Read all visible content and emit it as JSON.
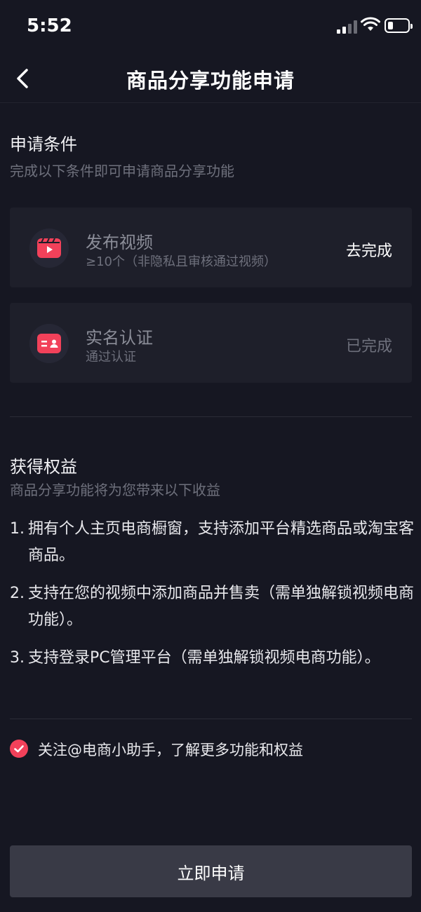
{
  "status_bar": {
    "time": "5:52"
  },
  "nav": {
    "title": "商品分享功能申请"
  },
  "conditions": {
    "title": "申请条件",
    "subtitle": "完成以下条件即可申请商品分享功能",
    "items": [
      {
        "title": "发布视频",
        "subtitle": "≥10个（非隐私且审核通过视频）",
        "action": "去完成",
        "icon": "video-clapper-icon",
        "done": false
      },
      {
        "title": "实名认证",
        "subtitle": "通过认证",
        "action": "已完成",
        "icon": "id-card-icon",
        "done": true
      }
    ]
  },
  "benefits": {
    "title": "获得权益",
    "subtitle": "商品分享功能将为您带来以下收益",
    "items": [
      {
        "num": "1.",
        "text": "拥有个人主页电商橱窗，支持添加平台精选商品或淘宝客商品。"
      },
      {
        "num": "2.",
        "text": "支持在您的视频中添加商品并售卖（需单独解锁视频电商功能）。"
      },
      {
        "num": "3.",
        "text": "支持登录PC管理平台（需单独解锁视频电商功能）。"
      }
    ]
  },
  "follow": {
    "text": "关注@电商小助手，了解更多功能和权益",
    "checked": true
  },
  "submit": {
    "label": "立即申请"
  },
  "colors": {
    "background": "#161722",
    "accent": "#f2415a",
    "card": "#1e1f2a",
    "button": "#393a46"
  }
}
